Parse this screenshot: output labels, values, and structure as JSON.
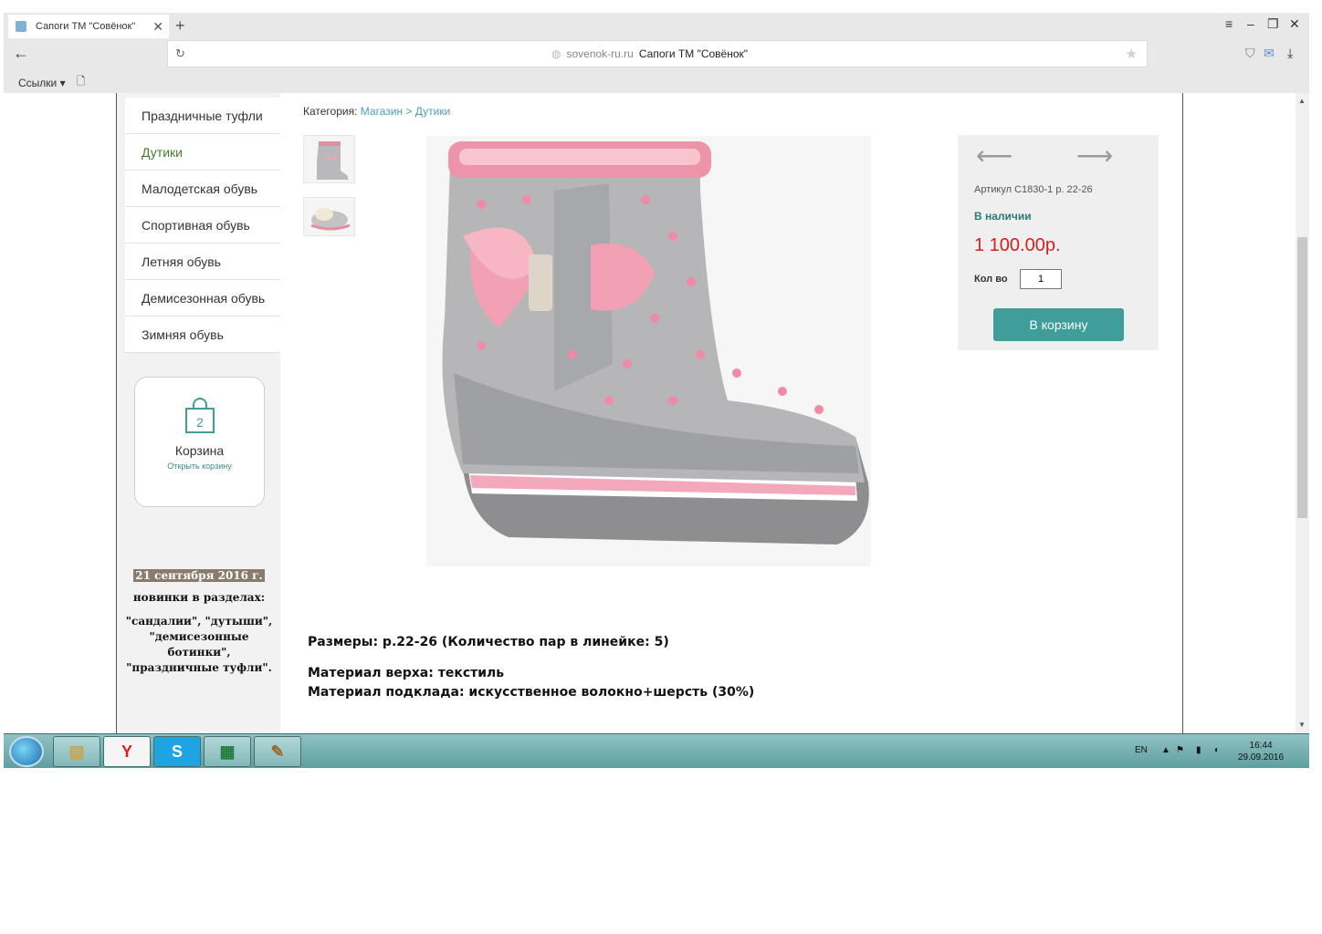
{
  "browser": {
    "tab_title": "Сапоги ТМ \"Совёнок\"",
    "tab_close": "✕",
    "new_tab": "+",
    "address_domain": "sovenok-ru.ru",
    "address_title": "Сапоги ТМ \"Совёнок\"",
    "bookmarks_label": "Ссылки"
  },
  "sidebar": {
    "categories": [
      {
        "label": "Праздничные туфли"
      },
      {
        "label": "Дутики"
      },
      {
        "label": "Малодетская обувь"
      },
      {
        "label": "Спортивная обувь"
      },
      {
        "label": "Летняя обувь"
      },
      {
        "label": "Демисезонная обувь"
      },
      {
        "label": "Зимняя обувь"
      }
    ],
    "cart": {
      "count": "2",
      "title": "Корзина",
      "link": "Открыть корзину"
    },
    "news": {
      "date": "21 сентября 2016 г.",
      "line1": "новинки в разделах:",
      "line2": "\"сандалии\", \"дутыши\", \"демисезонные ботинки\", \"праздничные туфли\"."
    }
  },
  "breadcrumb": {
    "prefix": "Категория:",
    "shop": "Магазин",
    "separator": ">",
    "category": "Дутики"
  },
  "product": {
    "sku": "Артикул С1830-1 р. 22-26",
    "stock": "В наличии",
    "price": "1 100.00р.",
    "qty_label": "Кол во",
    "qty_value": "1",
    "add_to_cart": "В корзину",
    "sizes": "Размеры: р.22-26 (Количество пар в линейке: 5)",
    "material_top": "Материал верха: текстиль",
    "material_lining": "Материал подклада: искусственное волокно+шерсть (30%)"
  },
  "taskbar": {
    "lang": "EN",
    "time": "16:44",
    "date": "29.09.2016"
  },
  "colors": {
    "accent": "#3f9d9a",
    "price": "#d32020",
    "stock": "#2e7b75",
    "link": "#4a9fb3"
  }
}
